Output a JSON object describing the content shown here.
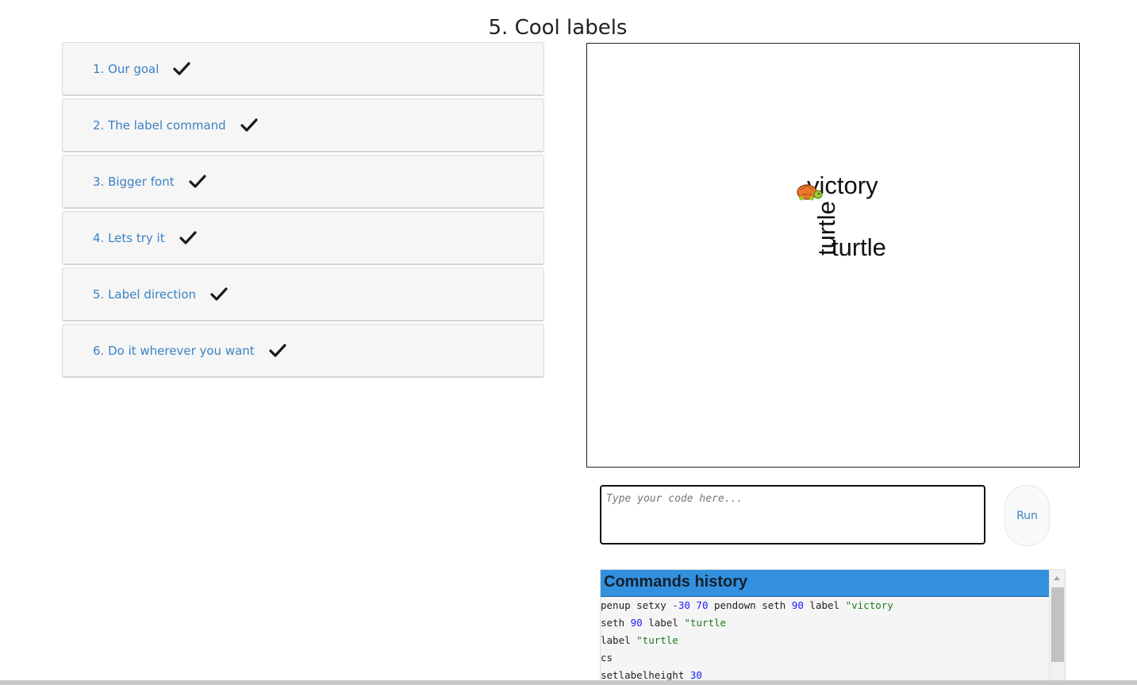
{
  "page": {
    "title": "5. Cool labels"
  },
  "steps": [
    {
      "label": "1. Our goal",
      "done": true
    },
    {
      "label": "2. The label command",
      "done": true
    },
    {
      "label": "3. Bigger font",
      "done": true
    },
    {
      "label": "4. Lets try it",
      "done": true
    },
    {
      "label": "5. Label direction",
      "done": true
    },
    {
      "label": "6. Do it wherever you want",
      "done": true
    }
  ],
  "canvas": {
    "labels": [
      {
        "text": "victory",
        "heading": 90
      },
      {
        "text": "turtle",
        "heading": 90
      },
      {
        "text": "turtle",
        "heading": 0
      }
    ],
    "turtle_icon": "turtle-icon"
  },
  "editor": {
    "placeholder": "Type your code here...",
    "run_label": "Run"
  },
  "history": {
    "title": "Commands history",
    "lines": [
      [
        {
          "t": "penup setxy "
        },
        {
          "t": "-30",
          "k": "num"
        },
        {
          "t": " "
        },
        {
          "t": "70",
          "k": "num"
        },
        {
          "t": " pendown seth "
        },
        {
          "t": "90",
          "k": "num"
        },
        {
          "t": " label "
        },
        {
          "t": "\"victory",
          "k": "str"
        }
      ],
      [
        {
          "t": "seth "
        },
        {
          "t": "90",
          "k": "num"
        },
        {
          "t": " label "
        },
        {
          "t": "\"turtle",
          "k": "str"
        }
      ],
      [
        {
          "t": "label "
        },
        {
          "t": "\"turtle",
          "k": "str"
        }
      ],
      [
        {
          "t": "cs"
        }
      ],
      [
        {
          "t": "setlabelheight "
        },
        {
          "t": "30",
          "k": "num"
        }
      ]
    ]
  },
  "colors": {
    "link": "#3b82c4",
    "history_header": "#3390de",
    "number": "#1a1aff",
    "string": "#1a7a1a"
  }
}
